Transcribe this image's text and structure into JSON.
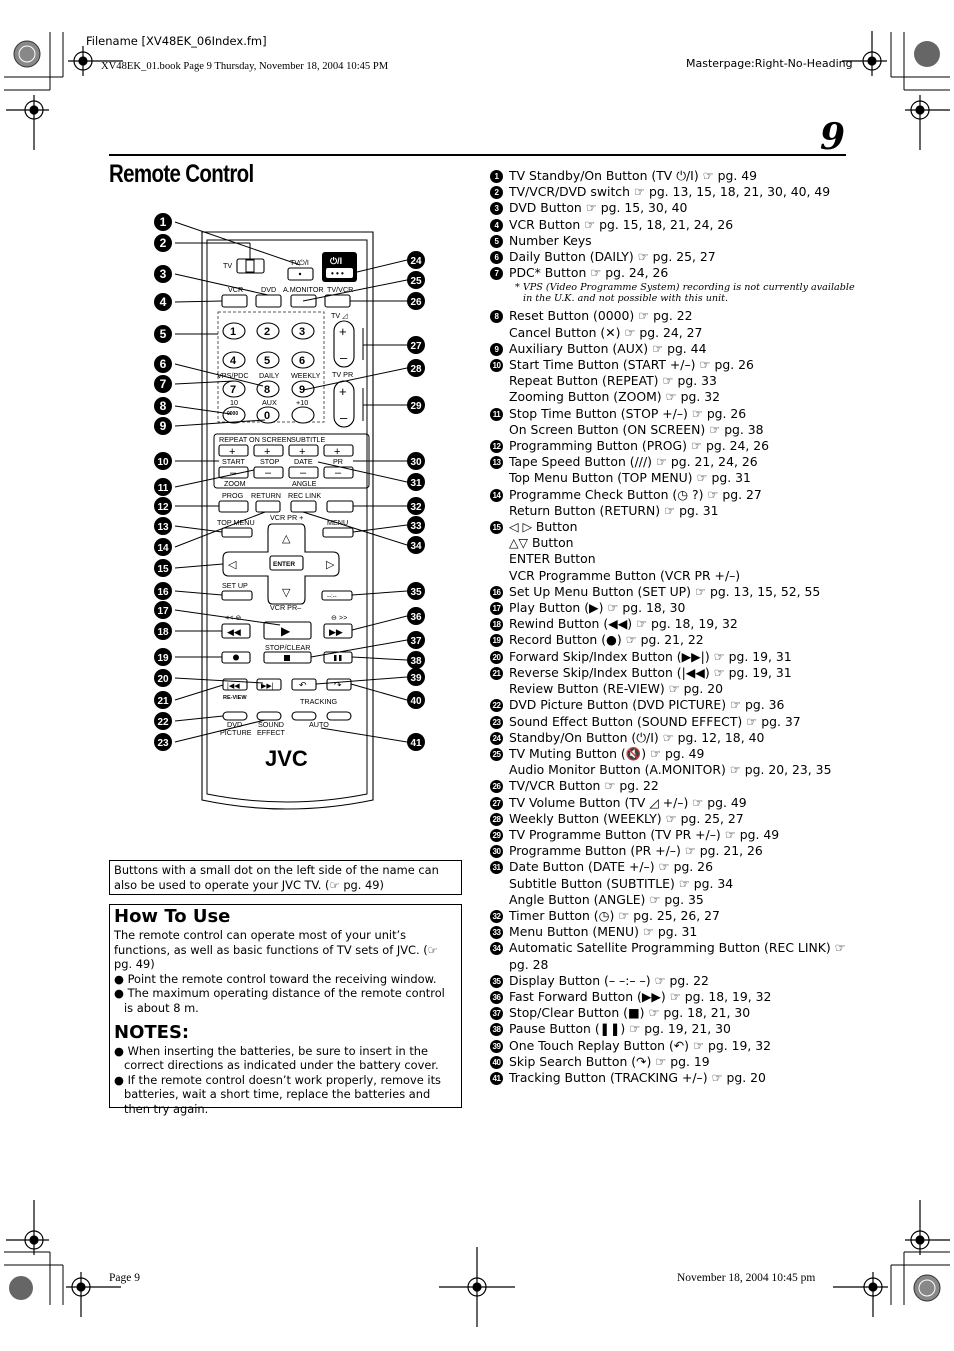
{
  "header": {
    "filename": "Filename [XV48EK_06Index.fm]",
    "book_line": "XV48EK_01.book  Page 9  Thursday, November 18, 2004  10:45 PM",
    "masterpage": "Masterpage:Right-No-Heading"
  },
  "page": {
    "title": "Remote Control",
    "number": "9"
  },
  "remote": {
    "brand": "JVC",
    "labels": {
      "tv_switch": "TV",
      "tv_power": "TV⏻/I",
      "power": "⏻/I",
      "vcr": "VCR",
      "dvd": "DVD",
      "amonitor": "A.MONITOR",
      "tvvcr": "TV/VCR",
      "tv_vol": "TV ◿",
      "tv_pr": "TV PR",
      "vps_pdc": "VPS/PDC",
      "daily": "DAILY",
      "weekly": "WEEKLY",
      "ten": "10",
      "aux": "AUX",
      "plus10": "+10",
      "repeat": "REPEAT",
      "on_screen": "ON SCREEN",
      "subtitle": "SUBTITLE",
      "start": "START",
      "stop": "STOP",
      "date": "DATE",
      "pr": "PR",
      "zoom": "ZOOM",
      "angle": "ANGLE",
      "prog": "PROG",
      "return": "RETURN",
      "rec_link": "REC LINK",
      "top_menu": "TOP MENU",
      "menu": "MENU",
      "vcr_pr_plus": "VCR PR +",
      "vcr_pr_minus": "VCR PR–",
      "enter": "ENTER",
      "set_up": "SET UP",
      "display": "--:--",
      "stop_clear": "STOP/CLEAR",
      "tracking": "TRACKING",
      "auto": "AUTO",
      "dvd_picture_1": "DVD",
      "dvd_picture_2": "PICTURE",
      "sound_effect_1": "SOUND",
      "sound_effect_2": "EFFECT",
      "review": "RE-VIEW"
    },
    "number_keys": [
      "1",
      "2",
      "3",
      "4",
      "5",
      "6",
      "7",
      "8",
      "9",
      "0"
    ]
  },
  "tv_note": "Buttons with a small dot on the left side of the name can also be used to operate your JVC TV. (☞ pg. 49)",
  "how_to_use": {
    "title": "How To Use",
    "intro": "The remote control can operate most of your unit’s functions, as well as basic functions of TV sets of JVC. (☞ pg. 49)",
    "bullets": [
      "Point the remote control toward the receiving window.",
      "The maximum operating distance of the remote control is about 8 m."
    ]
  },
  "notes": {
    "title": "NOTES:",
    "bullets": [
      "When inserting the batteries, be sure to insert in the correct directions as indicated under the battery cover.",
      "If the remote control doesn’t work properly, remove its batteries, wait a short time, replace the batteries and then try again."
    ]
  },
  "buttons": [
    {
      "n": "1",
      "lines": [
        "TV Standby/On Button (TV ⏻/I) ☞ pg. 49"
      ]
    },
    {
      "n": "2",
      "lines": [
        "TV/VCR/DVD switch ☞ pg. 13, 15, 18, 21, 30, 40, 49"
      ]
    },
    {
      "n": "3",
      "lines": [
        "DVD Button ☞ pg. 15, 30, 40"
      ]
    },
    {
      "n": "4",
      "lines": [
        "VCR Button ☞ pg. 15, 18, 21, 24, 26"
      ]
    },
    {
      "n": "5",
      "lines": [
        "Number Keys"
      ]
    },
    {
      "n": "6",
      "lines": [
        "Daily Button (DAILY) ☞ pg. 25, 27"
      ]
    },
    {
      "n": "7",
      "lines": [
        "PDC* Button ☞ pg. 24, 26"
      ],
      "footnote": "* VPS (Video Programme System) recording is not currently available in the U.K. and not possible with this unit."
    },
    {
      "n": "8",
      "lines": [
        "Reset Button (0000) ☞ pg. 22",
        "Cancel Button (✕) ☞ pg. 24, 27"
      ]
    },
    {
      "n": "9",
      "lines": [
        "Auxiliary Button (AUX) ☞ pg. 44"
      ]
    },
    {
      "n": "10",
      "lines": [
        "Start Time Button (START +/–) ☞ pg. 26",
        "Repeat Button (REPEAT) ☞ pg. 33",
        "Zooming Button (ZOOM) ☞ pg. 32"
      ]
    },
    {
      "n": "11",
      "lines": [
        "Stop Time Button (STOP +/–) ☞ pg. 26",
        "On Screen Button (ON SCREEN) ☞ pg. 38"
      ]
    },
    {
      "n": "12",
      "lines": [
        "Programming Button (PROG) ☞ pg. 24, 26"
      ]
    },
    {
      "n": "13",
      "lines": [
        "Tape Speed Button (///) ☞ pg. 21, 24, 26",
        "Top Menu Button (TOP MENU) ☞ pg. 31"
      ]
    },
    {
      "n": "14",
      "lines": [
        "Programme Check Button (◷ ?) ☞ pg. 27",
        "Return Button (RETURN) ☞ pg. 31"
      ]
    },
    {
      "n": "15",
      "lines": [
        "◁ ▷ Button",
        "△▽ Button",
        "ENTER Button",
        "VCR Programme Button (VCR PR +/–)"
      ]
    },
    {
      "n": "16",
      "lines": [
        "Set Up Menu Button (SET UP) ☞ pg. 13, 15, 52, 55"
      ]
    },
    {
      "n": "17",
      "lines": [
        "Play Button (▶) ☞ pg. 18, 30"
      ]
    },
    {
      "n": "18",
      "lines": [
        "Rewind Button (◀◀) ☞ pg. 18, 19, 32"
      ]
    },
    {
      "n": "19",
      "lines": [
        "Record Button (●) ☞ pg. 21, 22"
      ]
    },
    {
      "n": "20",
      "lines": [
        "Forward Skip/Index Button (▶▶|) ☞ pg. 19, 31"
      ]
    },
    {
      "n": "21",
      "lines": [
        "Reverse Skip/Index Button (|◀◀) ☞ pg. 19, 31",
        "Review Button (RE-VIEW) ☞ pg. 20"
      ]
    },
    {
      "n": "22",
      "lines": [
        "DVD Picture Button (DVD PICTURE) ☞ pg. 36"
      ]
    },
    {
      "n": "23",
      "lines": [
        "Sound Effect Button (SOUND EFFECT) ☞ pg. 37"
      ]
    },
    {
      "n": "24",
      "lines": [
        "Standby/On Button (⏻/I) ☞ pg. 12, 18, 40"
      ]
    },
    {
      "n": "25",
      "lines": [
        "TV Muting Button (🔇) ☞ pg. 49",
        "Audio Monitor Button (A.MONITOR) ☞ pg. 20, 23, 35"
      ]
    },
    {
      "n": "26",
      "lines": [
        "TV/VCR Button ☞ pg. 22"
      ]
    },
    {
      "n": "27",
      "lines": [
        "TV Volume Button (TV ◿ +/–) ☞ pg. 49"
      ]
    },
    {
      "n": "28",
      "lines": [
        "Weekly Button (WEEKLY) ☞ pg. 25, 27"
      ]
    },
    {
      "n": "29",
      "lines": [
        "TV Programme Button (TV PR +/–) ☞ pg. 49"
      ]
    },
    {
      "n": "30",
      "lines": [
        "Programme Button (PR +/–) ☞ pg. 21, 26"
      ]
    },
    {
      "n": "31",
      "lines": [
        "Date Button (DATE +/–) ☞ pg. 26",
        "Subtitle Button (SUBTITLE) ☞ pg. 34",
        "Angle Button (ANGLE) ☞ pg. 35"
      ]
    },
    {
      "n": "32",
      "lines": [
        "Timer Button (◷) ☞ pg. 25, 26, 27"
      ]
    },
    {
      "n": "33",
      "lines": [
        "Menu Button (MENU) ☞ pg. 31"
      ]
    },
    {
      "n": "34",
      "lines": [
        "Automatic Satellite Programming Button (REC LINK) ☞ pg. 28"
      ]
    },
    {
      "n": "35",
      "lines": [
        "Display Button (– –:– –) ☞ pg. 22"
      ]
    },
    {
      "n": "36",
      "lines": [
        "Fast Forward Button (▶▶) ☞ pg. 18, 19, 32"
      ]
    },
    {
      "n": "37",
      "lines": [
        "Stop/Clear Button (■) ☞ pg. 18, 21, 30"
      ]
    },
    {
      "n": "38",
      "lines": [
        "Pause Button (❚❚) ☞ pg. 19, 21, 30"
      ]
    },
    {
      "n": "39",
      "lines": [
        "One Touch Replay Button (↶) ☞ pg. 19, 32"
      ]
    },
    {
      "n": "40",
      "lines": [
        "Skip Search Button (↷) ☞ pg. 19"
      ]
    },
    {
      "n": "41",
      "lines": [
        "Tracking Button (TRACKING +/–) ☞ pg. 20"
      ]
    }
  ],
  "footer": {
    "page_label": "Page 9",
    "date": "November 18, 2004 10:45 pm"
  }
}
